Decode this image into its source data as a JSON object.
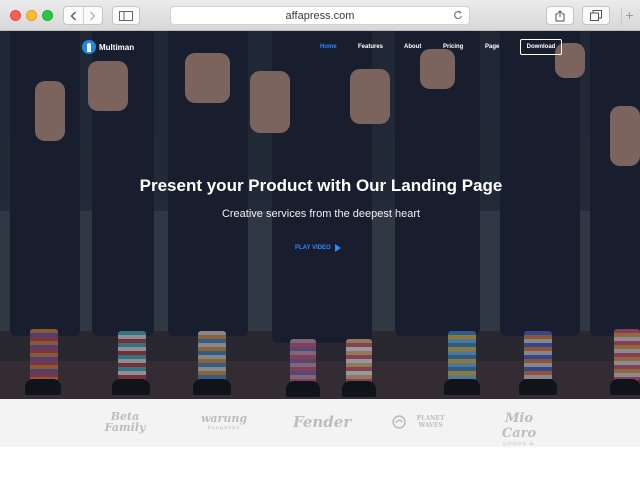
{
  "browser": {
    "url": "affapress.com",
    "buttons": [
      "back",
      "forward",
      "sidebar",
      "reload",
      "share",
      "tabs",
      "new-tab"
    ]
  },
  "site": {
    "brand": "Multiman",
    "nav": [
      {
        "label": "Home",
        "active": true
      },
      {
        "label": "Features",
        "active": false
      },
      {
        "label": "About",
        "active": false
      },
      {
        "label": "Pricing",
        "active": false
      },
      {
        "label": "Page",
        "active": false
      }
    ],
    "download_label": "Download",
    "hero": {
      "title": "Present your Product with Our Landing Page",
      "subtitle": "Creative services from the deepest heart",
      "play_label": "PLAY VIDEO"
    },
    "clients": [
      {
        "name": "Beta Family",
        "sub": ""
      },
      {
        "name": "warung",
        "sub": "bangkebo"
      },
      {
        "name": "Fender",
        "sub": ""
      },
      {
        "name": "PLANET WAVES",
        "sub": ""
      },
      {
        "name": "Mio Caro",
        "sub": "LOGOS & COMPANIES"
      }
    ]
  },
  "colors": {
    "accent": "#2f86ff",
    "logo_mark": "#1e88e5",
    "hero_overlay": "#121826",
    "strip": "#f3f3f3"
  }
}
